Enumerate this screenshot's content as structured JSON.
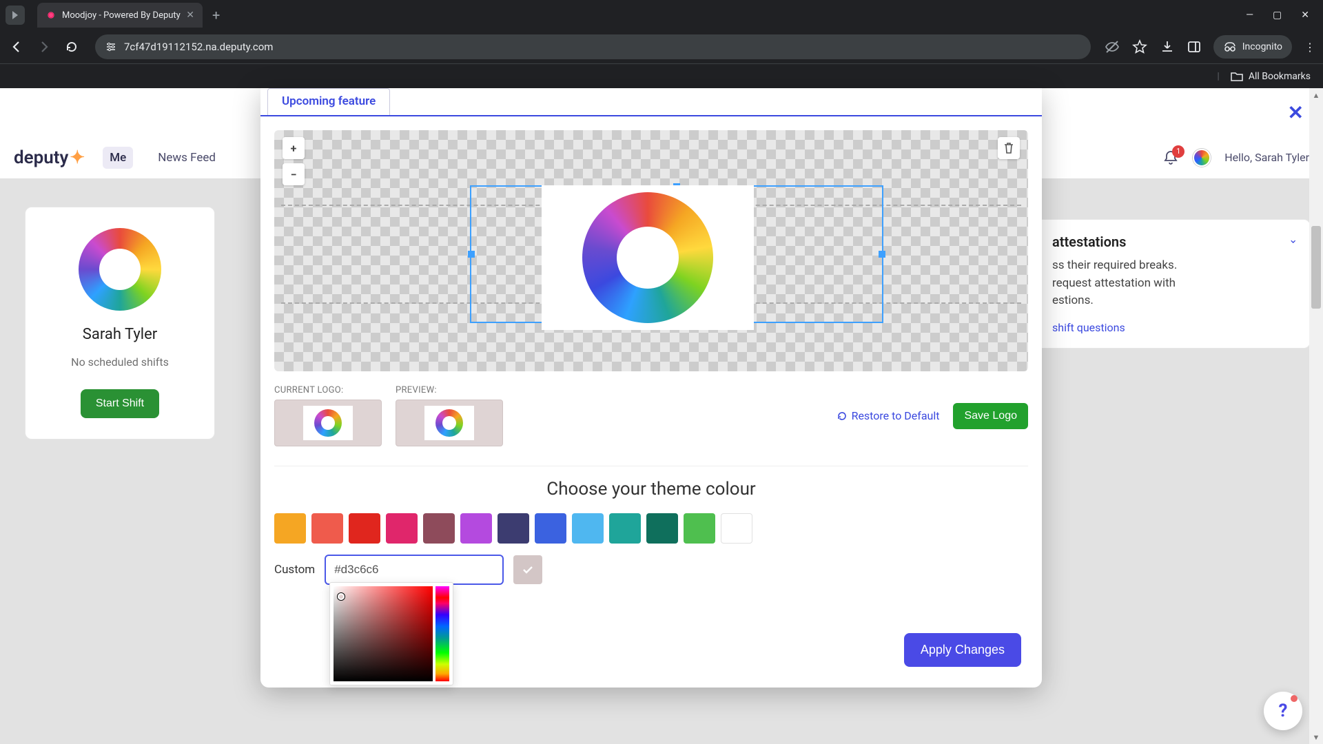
{
  "browser": {
    "tab_title": "Moodjoy - Powered By Deputy",
    "url": "7cf47d19112152.na.deputy.com",
    "incognito_label": "Incognito",
    "all_bookmarks": "All Bookmarks"
  },
  "app": {
    "logo_text": "deputy",
    "tabs": {
      "me": "Me",
      "newsfeed": "News Feed"
    },
    "hello": "Hello, Sarah Tyler",
    "bell_count": "1"
  },
  "profile": {
    "name": "Sarah Tyler",
    "no_shifts": "No scheduled shifts",
    "start_shift": "Start Shift"
  },
  "panel": {
    "title_tail": "attestations",
    "body_l1": "ss their required breaks.",
    "body_l2": "request attestation with",
    "body_l3": "estions.",
    "link": "shift questions"
  },
  "modal": {
    "tab_label": "Upcoming feature",
    "zoom_in": "+",
    "zoom_out": "−",
    "current_logo": "CURRENT LOGO:",
    "preview": "PREVIEW:",
    "restore": "Restore to Default",
    "save_logo": "Save Logo",
    "theme_title": "Choose your theme colour",
    "swatches": [
      "#f5a623",
      "#ef5b4c",
      "#e0261e",
      "#e0266b",
      "#8e4b5b",
      "#b44adf",
      "#3c3c70",
      "#3b62e0",
      "#4fb7f0",
      "#1fa59a",
      "#0f6f5c",
      "#4fbf4f"
    ],
    "custom_label": "Custom",
    "custom_value": "#d3c6c6",
    "apply": "Apply Changes"
  }
}
